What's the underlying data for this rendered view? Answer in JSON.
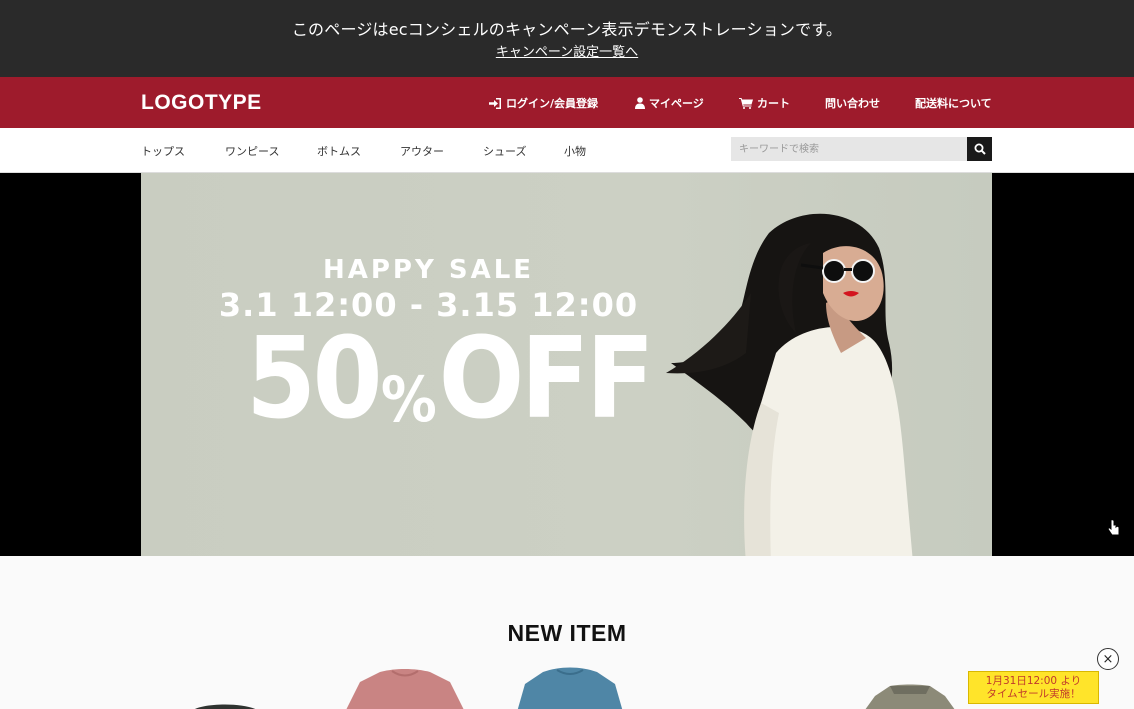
{
  "notice": {
    "message": "このページはecコンシェルのキャンペーン表示デモンストレーションです。",
    "link": "キャンペーン設定一覧へ"
  },
  "header": {
    "logo": "LOGOTYPE",
    "nav": {
      "login": "ログイン/会員登録",
      "mypage": "マイページ",
      "cart": "カート",
      "contact": "問い合わせ",
      "shipping": "配送料について"
    },
    "icons": [
      "login-icon",
      "user-icon",
      "cart-icon",
      "search-icon"
    ]
  },
  "categories": [
    "トップス",
    "ワンピース",
    "ボトムス",
    "アウター",
    "シューズ",
    "小物"
  ],
  "search": {
    "placeholder": "キーワードで検索",
    "value": ""
  },
  "hero": {
    "headline": "HAPPY SALE",
    "period": "3.1 12:00 - 3.15 12:00",
    "discount_number": "50",
    "discount_percent": "%",
    "discount_word": "OFF"
  },
  "section": {
    "title": "NEW ITEM"
  },
  "products": [
    {
      "name": "dark-knit",
      "color": "#2f3330"
    },
    {
      "name": "pink-sweater",
      "color": "#c98483"
    },
    {
      "name": "blue-sweater",
      "color": "#4f86a6"
    },
    {
      "name": "grey-turtleneck",
      "color": "#8c8a78"
    }
  ],
  "timesale": {
    "close": "×",
    "line1": "1月31日12:00 より",
    "line2": "タイムセール実施！"
  },
  "colors": {
    "header": "#9e1b2c",
    "notice": "#2a2a2a",
    "timesale": "#ffe42a"
  }
}
